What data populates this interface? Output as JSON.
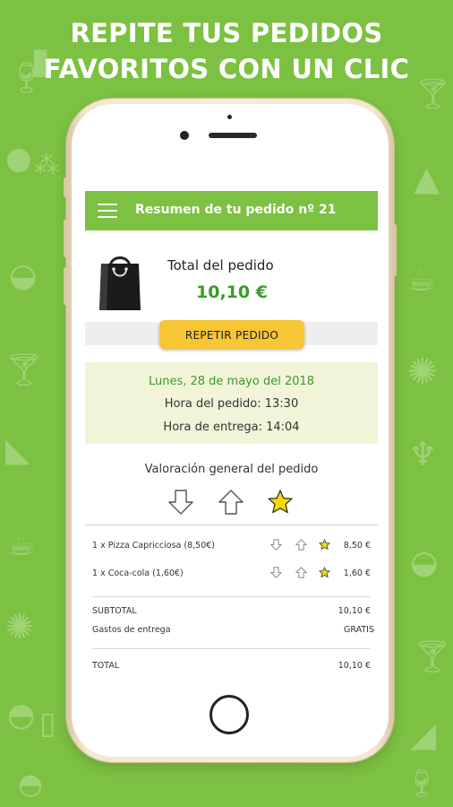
{
  "headline": {
    "line1": "REPITE TUS PEDIDOS",
    "line2": "FAVORITOS CON UN CLIC"
  },
  "app_bar": {
    "menu_icon": "hamburger-icon",
    "title": "Resumen de tu pedido nº 21"
  },
  "order_total": {
    "icon": "shopping-bag-icon",
    "label": "Total del pedido",
    "amount": "10,10 €"
  },
  "repeat_button": {
    "label": "REPETIR PEDIDO"
  },
  "order_info": {
    "date": "Lunes, 28 de mayo del 2018",
    "order_time": "Hora del pedido: 13:30",
    "delivery_time": "Hora de entrega: 14:04"
  },
  "rating": {
    "title": "Valoración general del pedido",
    "options": [
      "thumb-down-arrow-icon",
      "thumb-up-arrow-icon",
      "star-icon"
    ],
    "selected": "star-icon"
  },
  "items": [
    {
      "description": "1 x Pizza Capricciosa (8,50€)",
      "price": "8,50 €",
      "rating": "star"
    },
    {
      "description": "1 x Coca-cola (1,60€)",
      "price": "1,60 €",
      "rating": "star"
    }
  ],
  "summary": {
    "subtotal_label": "SUBTOTAL",
    "subtotal_value": "10,10 €",
    "delivery_label": "Gastos de entrega",
    "delivery_value": "GRATIS",
    "total_label": "TOTAL",
    "total_value": "10,10 €"
  },
  "colors": {
    "brand_green": "#7cc142",
    "amount_green": "#3a9b2a",
    "button_yellow": "#f8c534",
    "star_yellow": "#f5d90a",
    "info_panel": "#f2f4d9"
  },
  "background_icons": [
    "wine-glass-icon",
    "bottle-icon",
    "cocktail-icon",
    "apple-icon",
    "grapes-icon",
    "cake-icon",
    "noodle-bowl-icon",
    "coffee-cup-icon",
    "citrus-slice-icon",
    "ice-cream-icon",
    "burger-icon",
    "popsicle-icon"
  ]
}
